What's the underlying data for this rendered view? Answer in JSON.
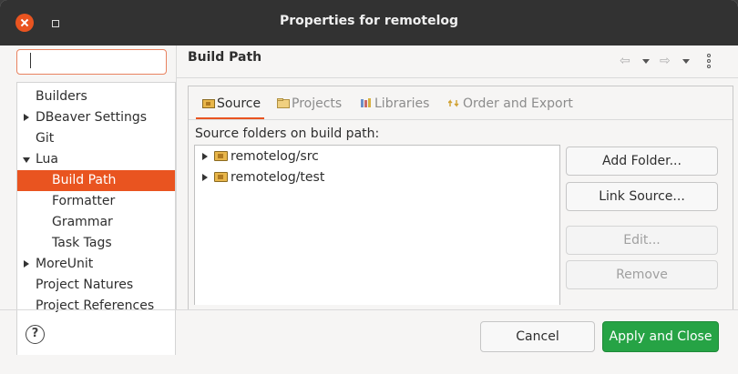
{
  "window": {
    "title": "Properties for remotelog"
  },
  "filter": {
    "value": "",
    "placeholder": ""
  },
  "tree": {
    "items": [
      {
        "label": "Builders",
        "expander": "none",
        "selected": false
      },
      {
        "label": "DBeaver Settings",
        "expander": "collapsed",
        "selected": false
      },
      {
        "label": "Git",
        "expander": "none",
        "selected": false
      },
      {
        "label": "Lua",
        "expander": "expanded",
        "selected": false
      },
      {
        "label": "Build Path",
        "expander": "none",
        "selected": true
      },
      {
        "label": "Formatter",
        "expander": "none",
        "selected": false
      },
      {
        "label": "Grammar",
        "expander": "none",
        "selected": false
      },
      {
        "label": "Task Tags",
        "expander": "none",
        "selected": false
      },
      {
        "label": "MoreUnit",
        "expander": "collapsed",
        "selected": false
      },
      {
        "label": "Project Natures",
        "expander": "none",
        "selected": false
      },
      {
        "label": "Project References",
        "expander": "none",
        "selected": false
      }
    ]
  },
  "page": {
    "title": "Build Path",
    "nav": {
      "back": "⇦",
      "forward": "⇨"
    }
  },
  "tabs": [
    {
      "label": "Source",
      "icon": "source-folder-icon",
      "active": true
    },
    {
      "label": "Projects",
      "icon": "projects-icon",
      "active": false
    },
    {
      "label": "Libraries",
      "icon": "libraries-icon",
      "active": false
    },
    {
      "label": "Order and Export",
      "icon": "order-export-icon",
      "active": false
    }
  ],
  "source": {
    "label": "Source folders on build path:",
    "folders": [
      "remotelog/src",
      "remotelog/test"
    ]
  },
  "buttons": {
    "add_folder": "Add Folder...",
    "link_source": "Link Source...",
    "edit": "Edit...",
    "remove": "Remove"
  },
  "footer": {
    "help": "?",
    "cancel": "Cancel",
    "apply_close": "Apply and Close"
  },
  "colors": {
    "accent": "#e95420",
    "apply": "#26a345",
    "titlebar": "#323232"
  }
}
